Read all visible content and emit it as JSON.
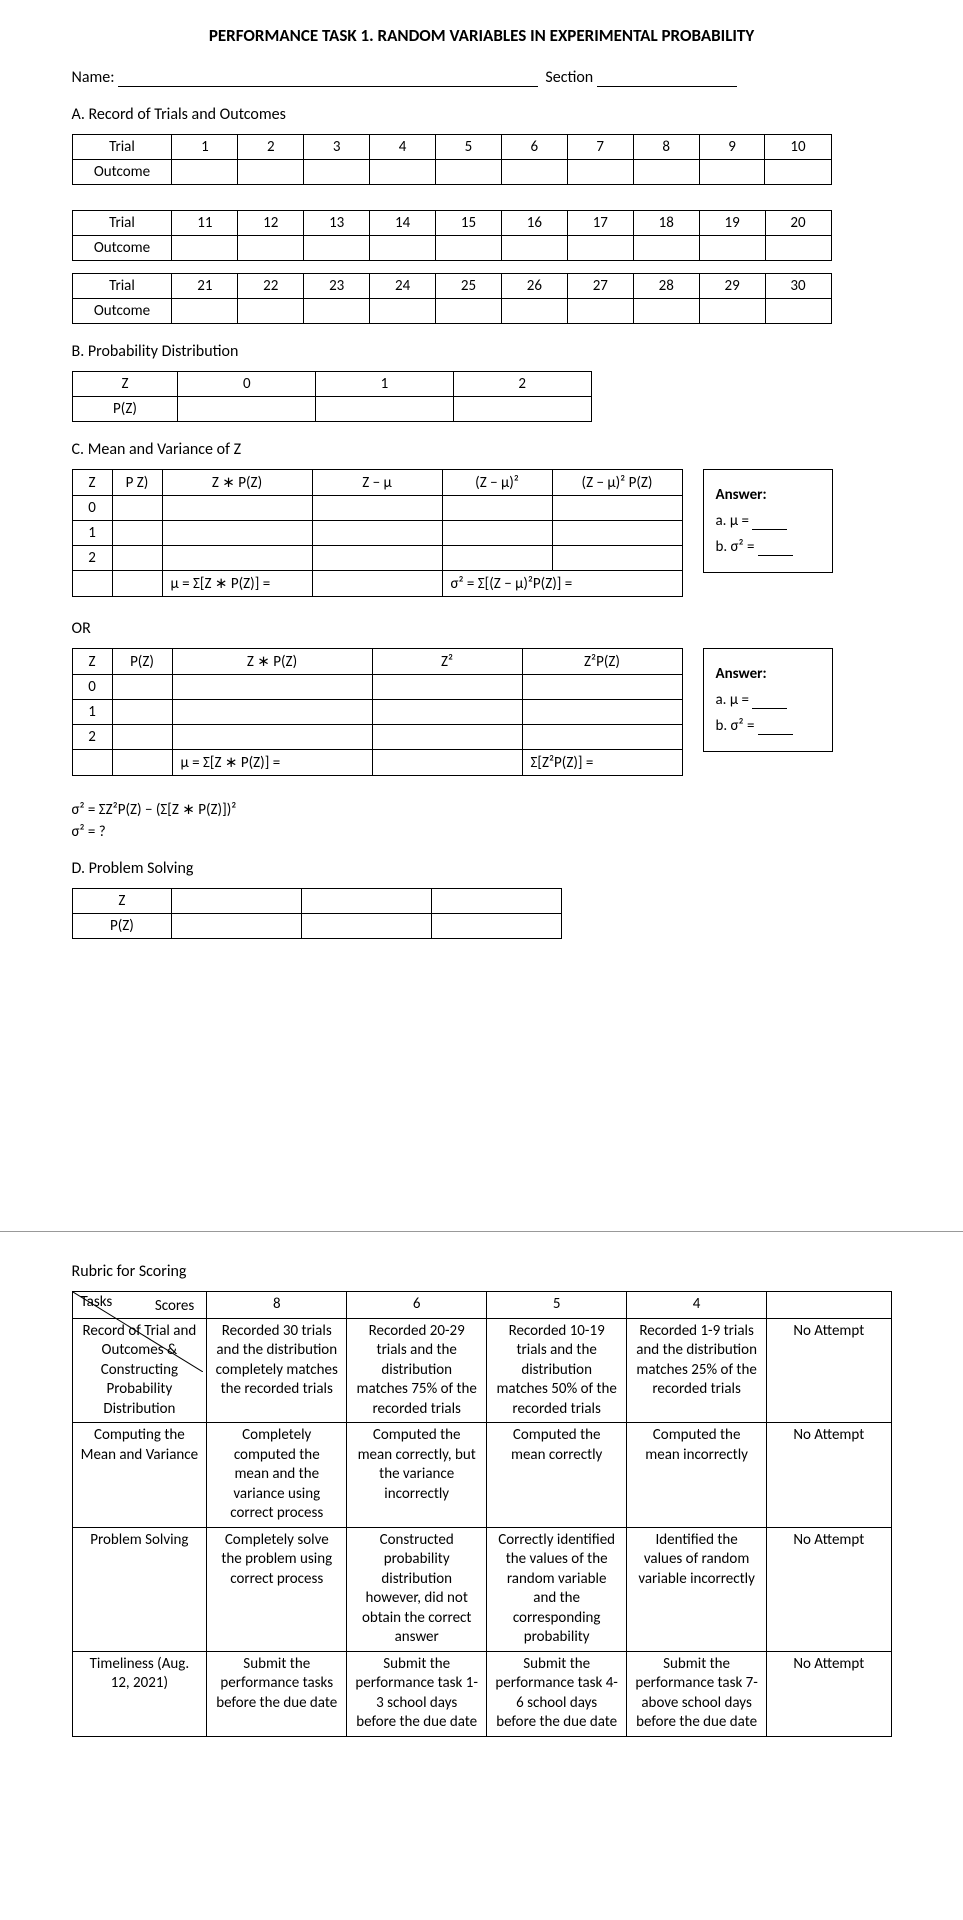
{
  "title": "PERFORMANCE TASK 1. RANDOM VARIABLES IN EXPERIMENTAL PROBABILITY",
  "name_label": "Name:",
  "section_label": "Section",
  "sectionA": {
    "heading": "A. Record of Trials and Outcomes",
    "trial_label": "Trial",
    "outcome_label": "Outcome",
    "rows": [
      [
        "1",
        "2",
        "3",
        "4",
        "5",
        "6",
        "7",
        "8",
        "9",
        "10"
      ],
      [
        "11",
        "12",
        "13",
        "14",
        "15",
        "16",
        "17",
        "18",
        "19",
        "20"
      ],
      [
        "21",
        "22",
        "23",
        "24",
        "25",
        "26",
        "27",
        "28",
        "29",
        "30"
      ]
    ]
  },
  "sectionB": {
    "heading": "B. Probability Distribution",
    "z_label": "Z",
    "pz_label": "P(Z)",
    "vals": [
      "0",
      "1",
      "2"
    ]
  },
  "sectionC": {
    "heading": "C. Mean and Variance of Z",
    "t1": {
      "h": [
        "Z",
        "P Z)",
        "Z ∗ P(Z)",
        "Z − μ",
        "(Z − μ)²",
        "(Z − μ)² P(Z)"
      ],
      "rows": [
        "0",
        "1",
        "2"
      ],
      "mu_formula": "μ = Σ[Z ∗ P(Z)] =",
      "sigma_formula": "σ² = Σ[(Z − μ)²P(Z)] ="
    },
    "or_label": "OR",
    "t2": {
      "h": [
        "Z",
        "P(Z)",
        "Z ∗ P(Z)",
        "Z²",
        "Z²P(Z)"
      ],
      "rows": [
        "0",
        "1",
        "2"
      ],
      "mu_formula": "μ = Σ[Z ∗ P(Z)] =",
      "sigma_formula": "Σ[Z²P(Z)] ="
    },
    "answer_label": "Answer:",
    "ans_a": "a. μ =",
    "ans_b": "b. σ² =",
    "formula1": "σ² = ΣZ²P(Z) − (Σ[Z ∗ P(Z)])²",
    "formula2": "σ² = ?"
  },
  "sectionD": {
    "heading": "D. Problem Solving",
    "z_label": "Z",
    "pz_label": "P(Z)"
  },
  "rubric": {
    "heading": "Rubric for Scoring",
    "scores_label": "Scores",
    "tasks_label": "Tasks",
    "score_headers": [
      "8",
      "6",
      "5",
      "4",
      ""
    ],
    "rows": [
      {
        "task": "Record of Trial and Outcomes & Constructing Probability Distribution",
        "c": [
          "Recorded 30 trials and the distribution completely matches the recorded trials",
          "Recorded 20-29 trials and the distribution matches 75% of the recorded trials",
          "Recorded 10-19 trials and the distribution matches 50% of the recorded trials",
          "Recorded 1-9 trials and the distribution matches 25% of the recorded trials",
          "No Attempt"
        ]
      },
      {
        "task": "Computing the Mean and Variance",
        "c": [
          "Completely computed the mean and the variance using correct process",
          "Computed the mean correctly, but the variance incorrectly",
          "Computed the mean correctly",
          "Computed the mean incorrectly",
          "No Attempt"
        ]
      },
      {
        "task": "Problem Solving",
        "c": [
          "Completely solve the problem using correct process",
          "Constructed probability distribution however, did not obtain the correct answer",
          "Correctly identified the values of the random variable and the corresponding probability",
          "Identified the values of random variable incorrectly",
          "No Attempt"
        ]
      },
      {
        "task": "Timeliness (Aug. 12, 2021)",
        "c": [
          "Submit the performance tasks before the due date",
          "Submit the performance task 1-3 school days before the due date",
          "Submit the performance task 4-6 school days before the due date",
          "Submit the performance task 7-above school days before the due date",
          "No Attempt"
        ]
      }
    ]
  }
}
